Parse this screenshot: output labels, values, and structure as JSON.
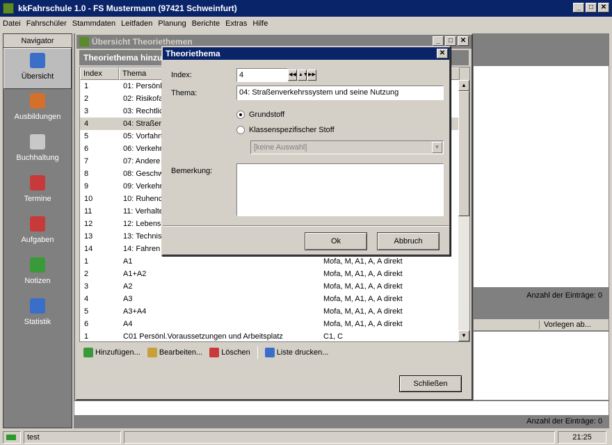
{
  "app": {
    "title": "kkFahrschule 1.0  -  FS Mustermann (97421 Schweinfurt)"
  },
  "menu": [
    "Datei",
    "Fahrschüler",
    "Stammdaten",
    "Leitfaden",
    "Planung",
    "Berichte",
    "Extras",
    "Hilfe"
  ],
  "navigator": {
    "header": "Navigator",
    "items": [
      {
        "label": "Übersicht",
        "icon": "overview-icon",
        "color": "#3a6ec8"
      },
      {
        "label": "Ausbildungen",
        "icon": "people-icon",
        "color": "#d4702a"
      },
      {
        "label": "Buchhaltung",
        "icon": "cash-register-icon",
        "color": "#c8c8c8"
      },
      {
        "label": "Termine",
        "icon": "calendar-icon",
        "color": "#c83a3a"
      },
      {
        "label": "Aufgaben",
        "icon": "book-icon",
        "color": "#c83a3a"
      },
      {
        "label": "Notizen",
        "icon": "notes-icon",
        "color": "#3a9a3a"
      },
      {
        "label": "Statistik",
        "icon": "chart-icon",
        "color": "#3a6ec8"
      }
    ]
  },
  "overview": {
    "title": "Übersicht Theoriethemen",
    "subheader": "Theoriethema hinzufügen",
    "columns": [
      "Index",
      "Thema"
    ],
    "rows": [
      [
        "1",
        "01: Persönl",
        ""
      ],
      [
        "2",
        "02: Risikofa",
        ""
      ],
      [
        "3",
        "03: Rechtlic",
        ""
      ],
      [
        "4",
        "04: Straßen",
        ""
      ],
      [
        "5",
        "05: Vorfahrt",
        ""
      ],
      [
        "6",
        "06: Verkehr",
        ""
      ],
      [
        "7",
        "07: Andere",
        ""
      ],
      [
        "8",
        "08: Geschw",
        ""
      ],
      [
        "9",
        "09: Verkehr",
        ""
      ],
      [
        "10",
        "10: Ruhenc",
        ""
      ],
      [
        "11",
        "11: Verhalte",
        ""
      ],
      [
        "12",
        "12: Lebensl",
        ""
      ],
      [
        "13",
        "13: Technis",
        ""
      ],
      [
        "14",
        "14: Fahren",
        ""
      ],
      [
        "1",
        "A1",
        "Mofa, M, A1, A, A direkt"
      ],
      [
        "2",
        "A1+A2",
        "Mofa, M, A1, A, A direkt"
      ],
      [
        "3",
        "A2",
        "Mofa, M, A1, A, A direkt"
      ],
      [
        "4",
        "A3",
        "Mofa, M, A1, A, A direkt"
      ],
      [
        "5",
        "A3+A4",
        "Mofa, M, A1, A, A direkt"
      ],
      [
        "6",
        "A4",
        "Mofa, M, A1, A, A direkt"
      ],
      [
        "1",
        "C01 Persönl.Voraussetzungen und Arbeitsplatz",
        "C1, C"
      ]
    ],
    "selected_row": 3,
    "toolbar": {
      "add": "Hinzufügen...",
      "edit": "Bearbeiten...",
      "delete": "Löschen",
      "print": "Liste drucken..."
    },
    "close": "Schließen"
  },
  "right": {
    "count1": "Anzahl der Einträge: 0",
    "vorlegen": "Vorlegen ab...",
    "count2": "Anzahl der Einträge: 0"
  },
  "dialog": {
    "title": "Theoriethema",
    "index_label": "Index:",
    "index_value": "4",
    "thema_label": "Thema:",
    "thema_value": "04: Straßenverkehrssystem und seine Nutzung",
    "radio1": "Grundstoff",
    "radio2": "Klassenspezifischer Stoff",
    "combo": "[keine Auswahl]",
    "remark_label": "Bemerkung:",
    "ok": "Ok",
    "cancel": "Abbruch"
  },
  "status": {
    "user": "test",
    "time": "21:25"
  }
}
